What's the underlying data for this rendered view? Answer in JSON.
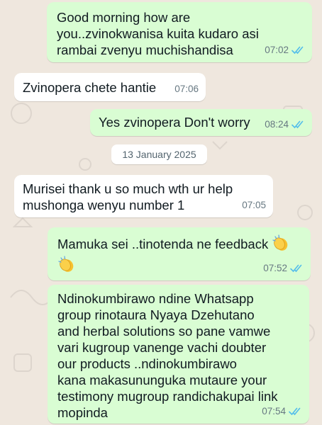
{
  "messages": [
    {
      "dir": "out",
      "text": "Good morning how are\nyou..zvinokwanisa kuita kudaro asi\nrambai zvenyu muchishandisa",
      "time": "07:02",
      "status": "read"
    },
    {
      "dir": "in",
      "text": "Zvinopera chete hantie",
      "time": "07:06"
    },
    {
      "dir": "out",
      "text": "Yes zvinopera Don't worry",
      "time": "08:24",
      "status": "read"
    },
    {
      "dir": "in",
      "text": "Murisei thank u so much wth ur help\nmushonga wenyu number 1",
      "time": "07:05"
    },
    {
      "dir": "out",
      "text": "Mamuka sei ..tinotenda ne feedback",
      "time": "07:52",
      "status": "read",
      "emoji": "clapping-hands"
    },
    {
      "dir": "out",
      "text": "Ndinokumbirawo ndine Whatsapp\ngroup rinotaura Nyaya Dzehutano\nand herbal solutions so pane vamwe\nvari kugroup vanenge vachi doubter\nour products ..ndinokumbirawo\nkana makasununguka mutaure your\ntestimony mugroup randichakupai link\nmopinda",
      "time": "07:54",
      "status": "read"
    }
  ],
  "date_separator": "13 January 2025",
  "colors": {
    "outgoing": "#d9fdd3",
    "incoming": "#ffffff",
    "read_tick": "#53bdeb",
    "wallpaper": "#efe7de"
  }
}
